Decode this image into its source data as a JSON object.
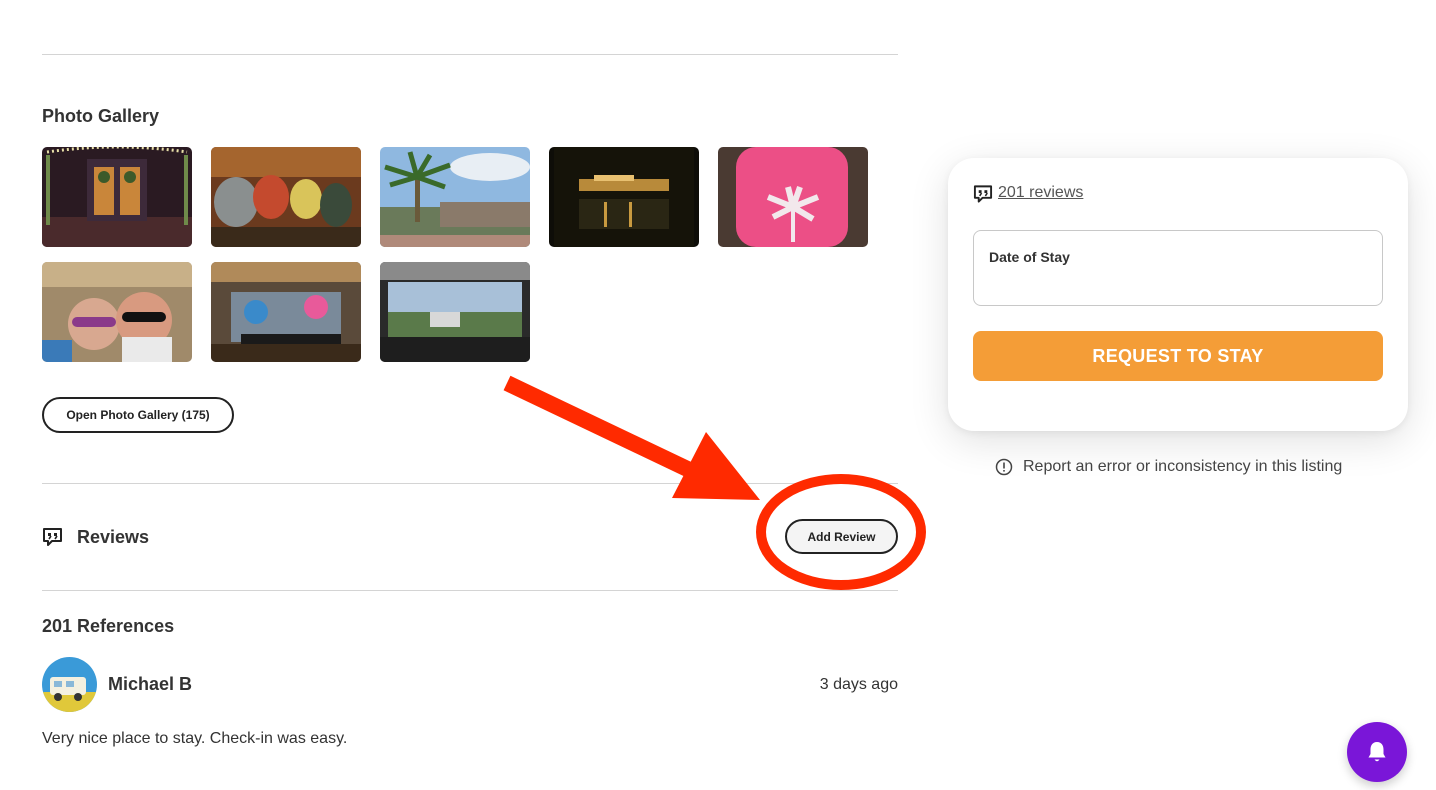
{
  "gallery": {
    "title": "Photo Gallery",
    "open_button_label": "Open Photo Gallery (175)"
  },
  "reviews": {
    "heading": "Reviews",
    "add_button_label": "Add Review",
    "references_title": "201 References",
    "items": [
      {
        "author": "Michael B",
        "time": "3 days ago",
        "text": "Very nice place to stay. Check-in was easy."
      }
    ]
  },
  "booking": {
    "reviews_link": "201 reviews",
    "date_label": "Date of Stay",
    "request_button": "REQUEST TO STAY",
    "report_text": "Report an error or inconsistency in this listing"
  },
  "colors": {
    "accent_orange": "#f49d37",
    "annotation_red": "#ff2a00",
    "bell_purple": "#7a16d8"
  },
  "icons": {
    "quote": "quote-bubble-icon",
    "info": "info-circle-icon",
    "bell": "bell-icon"
  }
}
